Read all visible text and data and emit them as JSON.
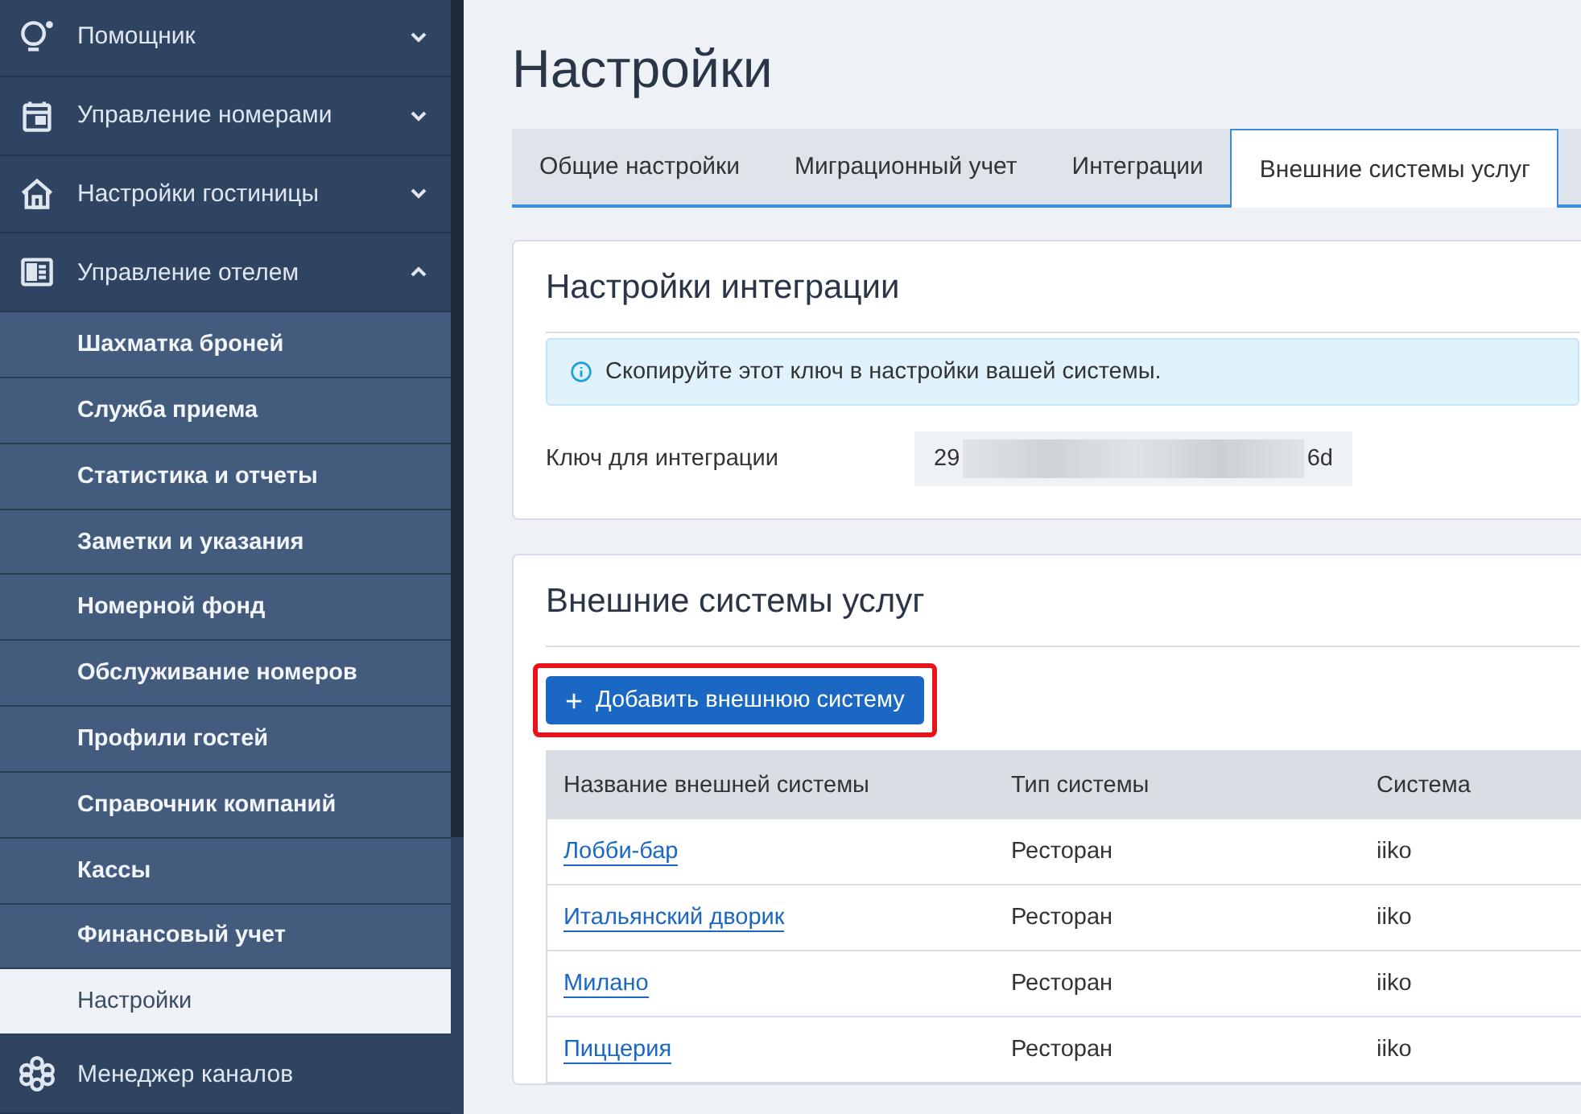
{
  "sidebar": {
    "items": [
      {
        "label": "Помощник",
        "expanded": false
      },
      {
        "label": "Управление номерами",
        "expanded": false
      },
      {
        "label": "Настройки гостиницы",
        "expanded": false
      },
      {
        "label": "Управление отелем",
        "expanded": true,
        "children": [
          {
            "label": "Шахматка броней",
            "selected": false
          },
          {
            "label": "Служба приема",
            "selected": false
          },
          {
            "label": "Статистика и отчеты",
            "selected": false
          },
          {
            "label": "Заметки и указания",
            "selected": false
          },
          {
            "label": "Номерной фонд",
            "selected": false
          },
          {
            "label": "Обслуживание номеров",
            "selected": false
          },
          {
            "label": "Профили гостей",
            "selected": false
          },
          {
            "label": "Справочник компаний",
            "selected": false
          },
          {
            "label": "Кассы",
            "selected": false
          },
          {
            "label": "Финансовый учет",
            "selected": false
          },
          {
            "label": "Настройки",
            "selected": true
          }
        ]
      },
      {
        "label": "Менеджер каналов"
      }
    ]
  },
  "page": {
    "title": "Настройки"
  },
  "tabs": [
    {
      "label": "Общие настройки",
      "selected": false
    },
    {
      "label": "Миграционный учет",
      "selected": false
    },
    {
      "label": "Интеграции",
      "selected": false
    },
    {
      "label": "Внешние системы услуг",
      "selected": true
    }
  ],
  "integration_card": {
    "title": "Настройки интеграции",
    "info": "Скопируйте этот ключ в настройки вашей системы.",
    "key_label": "Ключ для интеграции",
    "key_start": "29",
    "key_end": "6d"
  },
  "systems_card": {
    "title": "Внешние системы услуг",
    "add_button": {
      "label": "Добавить внешнюю систему",
      "highlighted": true
    },
    "table": {
      "columns": [
        "Название внешней системы",
        "Тип системы",
        "Система"
      ],
      "rows": [
        [
          "Лобби-бар",
          "Ресторан",
          "iiko"
        ],
        [
          "Итальянский дворик",
          "Ресторан",
          "iiko"
        ],
        [
          "Милано",
          "Ресторан",
          "iiko"
        ],
        [
          "Пиццерия",
          "Ресторан",
          "iiko"
        ]
      ]
    }
  }
}
